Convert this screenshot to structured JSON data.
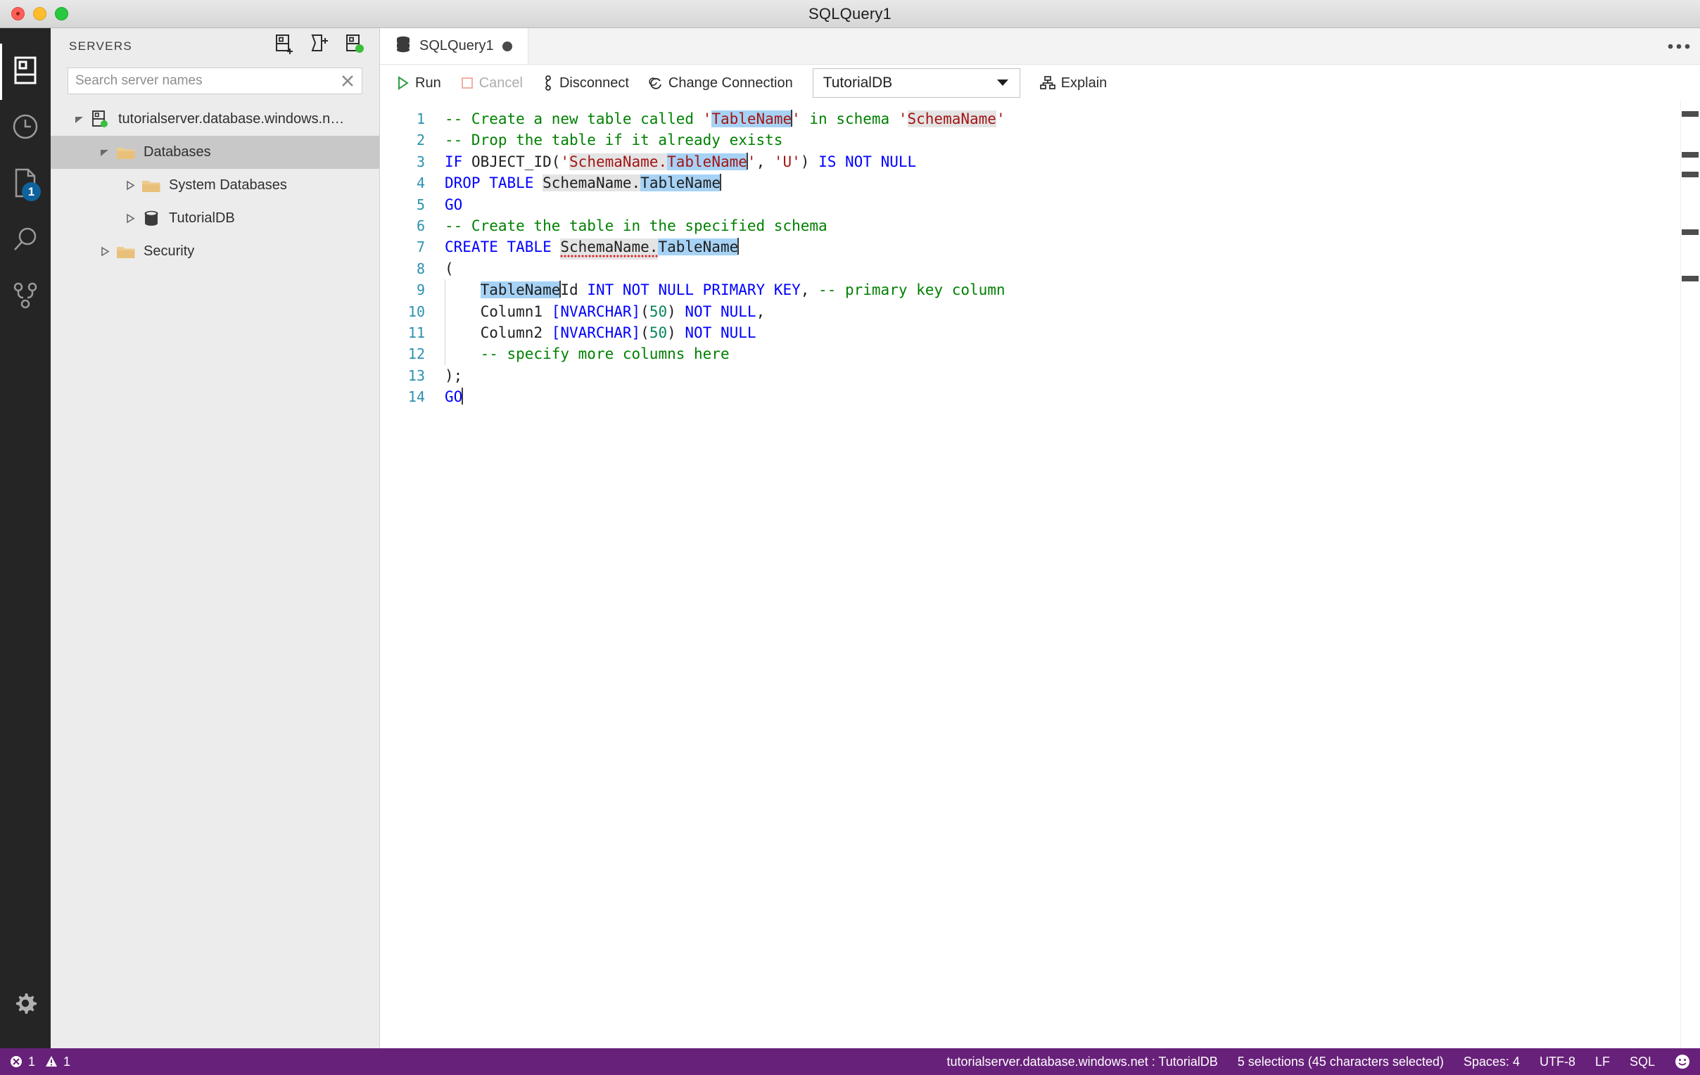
{
  "window": {
    "title": "SQLQuery1",
    "controls": {
      "close": "close-window",
      "minimize": "minimize-window",
      "maximize": "maximize-window"
    }
  },
  "activitybar": {
    "items": [
      {
        "name": "servers",
        "icon": "servers-icon",
        "active": true,
        "badge": null
      },
      {
        "name": "history",
        "icon": "clock-icon",
        "active": false,
        "badge": null
      },
      {
        "name": "explorer",
        "icon": "file-icon",
        "active": false,
        "badge": "1"
      },
      {
        "name": "search",
        "icon": "search-icon",
        "active": false,
        "badge": null
      },
      {
        "name": "source-control",
        "icon": "source-control-icon",
        "active": false,
        "badge": null
      }
    ],
    "bottom": {
      "name": "manage",
      "icon": "gear-icon"
    }
  },
  "sidebar": {
    "title": "SERVERS",
    "actions": [
      {
        "name": "new-connection",
        "icon": "add-server-icon"
      },
      {
        "name": "new-connection-group",
        "icon": "add-server-group-icon"
      },
      {
        "name": "show-active-connections",
        "icon": "active-connections-icon"
      }
    ],
    "search": {
      "placeholder": "Search server names",
      "value": "",
      "clear": "clear-search-icon"
    },
    "tree": [
      {
        "label": "tutorialserver.database.windows.n…",
        "level": 0,
        "twisty": "down",
        "icon": "server-connected-icon",
        "selected": false
      },
      {
        "label": "Databases",
        "level": 1,
        "twisty": "down",
        "icon": "folder-icon",
        "selected": true
      },
      {
        "label": "System Databases",
        "level": 2,
        "twisty": "right",
        "icon": "folder-icon",
        "selected": false
      },
      {
        "label": "TutorialDB",
        "level": 2,
        "twisty": "right",
        "icon": "database-icon",
        "selected": false
      },
      {
        "label": "Security",
        "level": 1,
        "twisty": "right",
        "icon": "folder-icon",
        "selected": false
      }
    ]
  },
  "editor": {
    "tab": {
      "label": "SQLQuery1",
      "icon": "database-query-icon",
      "dirty": true
    },
    "more_actions": "more-actions-icon",
    "toolbar": {
      "run": "Run",
      "cancel": "Cancel",
      "disconnect": "Disconnect",
      "change_connection": "Change Connection",
      "database": "TutorialDB",
      "explain": "Explain"
    },
    "lines": [
      {
        "n": "1",
        "tokens": [
          {
            "t": "-- Create a new table called ",
            "c": "cmt"
          },
          {
            "t": "'",
            "c": "str"
          },
          {
            "t": "TableName",
            "c": "str sel"
          },
          {
            "t": "|",
            "c": "caret"
          },
          {
            "t": "'",
            "c": "str"
          },
          {
            "t": " in schema ",
            "c": "cmt"
          },
          {
            "t": "'",
            "c": "str"
          },
          {
            "t": "SchemaName",
            "c": "str selw"
          },
          {
            "t": "'",
            "c": "str"
          }
        ]
      },
      {
        "n": "2",
        "tokens": [
          {
            "t": "-- Drop the table if it already exists",
            "c": "cmt"
          }
        ]
      },
      {
        "n": "3",
        "tokens": [
          {
            "t": "IF",
            "c": "kw"
          },
          {
            "t": " OBJECT_ID(",
            "c": "plain"
          },
          {
            "t": "'",
            "c": "str"
          },
          {
            "t": "SchemaName.",
            "c": "str selw"
          },
          {
            "t": "TableName",
            "c": "str sel"
          },
          {
            "t": "|",
            "c": "caret"
          },
          {
            "t": "'",
            "c": "str"
          },
          {
            "t": ", ",
            "c": "plain"
          },
          {
            "t": "'U'",
            "c": "str"
          },
          {
            "t": ") ",
            "c": "plain"
          },
          {
            "t": "IS NOT NULL",
            "c": "kw"
          }
        ]
      },
      {
        "n": "4",
        "tokens": [
          {
            "t": "DROP TABLE",
            "c": "kw"
          },
          {
            "t": " ",
            "c": "plain"
          },
          {
            "t": "SchemaName.",
            "c": "plain selw"
          },
          {
            "t": "TableName",
            "c": "plain sel"
          },
          {
            "t": "|",
            "c": "caret"
          }
        ]
      },
      {
        "n": "5",
        "tokens": [
          {
            "t": "GO",
            "c": "kw"
          }
        ]
      },
      {
        "n": "6",
        "tokens": [
          {
            "t": "-- Create the table in the specified schema",
            "c": "cmt"
          }
        ]
      },
      {
        "n": "7",
        "tokens": [
          {
            "t": "CREATE TABLE",
            "c": "kw"
          },
          {
            "t": " ",
            "c": "plain"
          },
          {
            "t": "SchemaName.",
            "c": "plain selw squiggle"
          },
          {
            "t": "TableName",
            "c": "plain sel"
          },
          {
            "t": "|",
            "c": "caret"
          }
        ]
      },
      {
        "n": "8",
        "tokens": [
          {
            "t": "(",
            "c": "plain"
          }
        ]
      },
      {
        "n": "9",
        "tokens": [
          {
            "t": "    ",
            "c": "plain"
          },
          {
            "t": "TableName",
            "c": "plain sel"
          },
          {
            "t": "|",
            "c": "caret"
          },
          {
            "t": "Id ",
            "c": "plain"
          },
          {
            "t": "INT NOT NULL PRIMARY KEY",
            "c": "kw"
          },
          {
            "t": ", ",
            "c": "plain"
          },
          {
            "t": "-- primary key column",
            "c": "cmt"
          }
        ],
        "guide": true
      },
      {
        "n": "10",
        "tokens": [
          {
            "t": "    Column1 ",
            "c": "plain"
          },
          {
            "t": "[NVARCHAR]",
            "c": "type"
          },
          {
            "t": "(",
            "c": "plain"
          },
          {
            "t": "50",
            "c": "num"
          },
          {
            "t": ") ",
            "c": "plain"
          },
          {
            "t": "NOT NULL",
            "c": "kw"
          },
          {
            "t": ",",
            "c": "plain"
          }
        ],
        "guide": true
      },
      {
        "n": "11",
        "tokens": [
          {
            "t": "    Column2 ",
            "c": "plain"
          },
          {
            "t": "[NVARCHAR]",
            "c": "type"
          },
          {
            "t": "(",
            "c": "plain"
          },
          {
            "t": "50",
            "c": "num"
          },
          {
            "t": ") ",
            "c": "plain"
          },
          {
            "t": "NOT NULL",
            "c": "kw"
          }
        ],
        "guide": true
      },
      {
        "n": "12",
        "tokens": [
          {
            "t": "    ",
            "c": "plain"
          },
          {
            "t": "-- specify more columns here",
            "c": "cmt"
          }
        ],
        "guide": true
      },
      {
        "n": "13",
        "tokens": [
          {
            "t": ");",
            "c": "plain"
          }
        ]
      },
      {
        "n": "14",
        "tokens": [
          {
            "t": "GO",
            "c": "kw"
          },
          {
            "t": "|",
            "c": "caret"
          }
        ]
      }
    ],
    "ruler_marks": [
      14,
      72,
      100,
      182,
      248
    ]
  },
  "statusbar": {
    "errors": "1",
    "warnings": "1",
    "connection": "tutorialserver.database.windows.net : TutorialDB",
    "selection": "5 selections (45 characters selected)",
    "spaces": "Spaces: 4",
    "encoding": "UTF-8",
    "eol": "LF",
    "language": "SQL",
    "feedback": "feedback-smiley-icon"
  },
  "colors": {
    "statusbar_bg": "#68217a",
    "accent_selection": "#a6d2f5",
    "badge_blue": "#0e639c",
    "keyword": "#0000ff",
    "comment": "#008000",
    "string": "#a31515",
    "number": "#098658",
    "folder": "#e8c07a",
    "connected_green": "#3cbf3c"
  }
}
